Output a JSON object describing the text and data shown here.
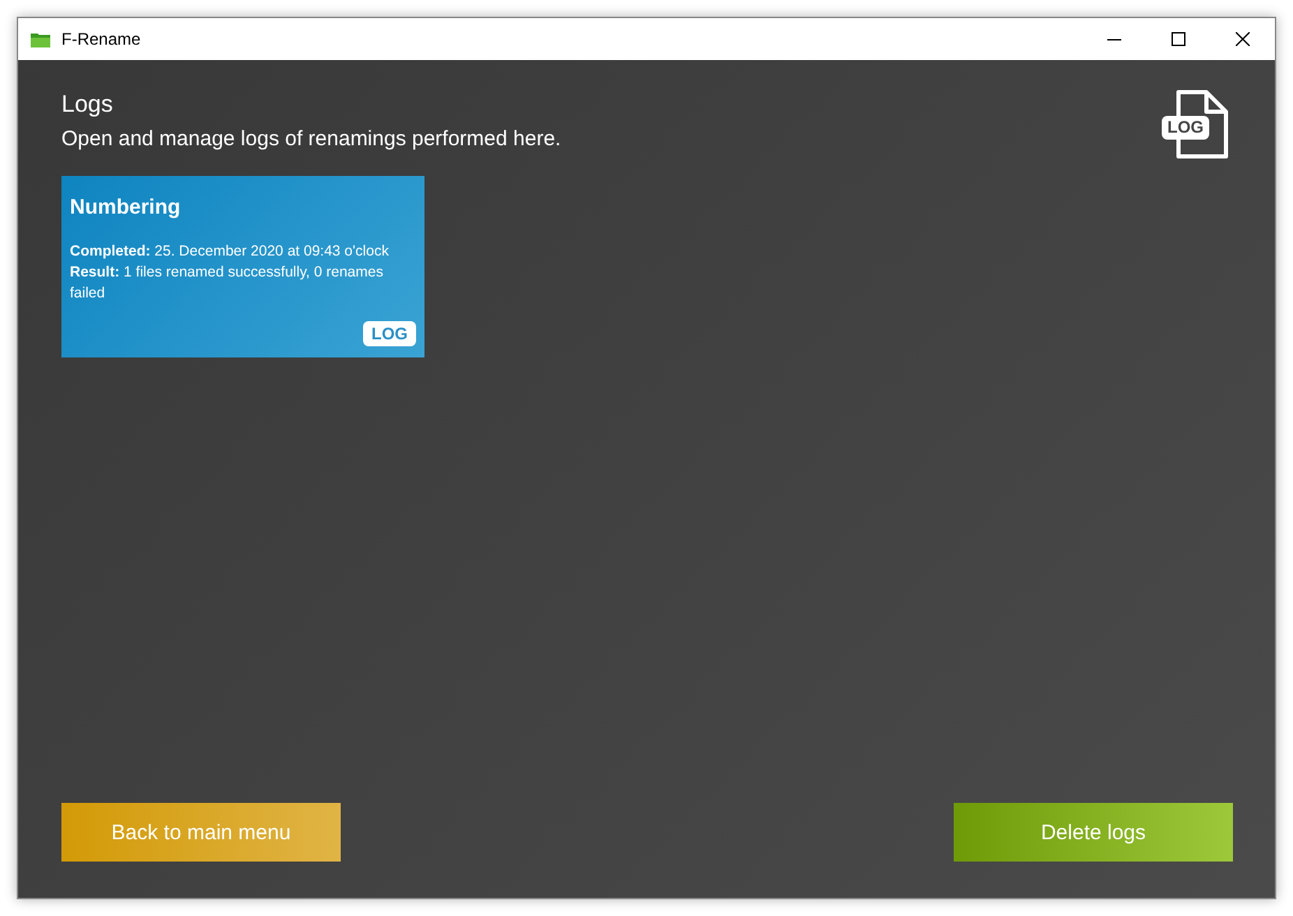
{
  "window": {
    "title": "F-Rename"
  },
  "header": {
    "title": "Logs",
    "subtitle": "Open and manage logs of renamings performed here.",
    "icon_label": "LOG"
  },
  "logs": [
    {
      "title": "Numbering",
      "completed_label": "Completed:",
      "completed": "25. December 2020 at 09:43 o'clock",
      "result_label": "Result:",
      "result": "1 files renamed successfully, 0 renames failed",
      "badge": "LOG"
    }
  ],
  "buttons": [
    {
      "label": "Back to main menu",
      "kind": "back"
    },
    {
      "label": "Delete logs",
      "kind": "delete"
    }
  ]
}
